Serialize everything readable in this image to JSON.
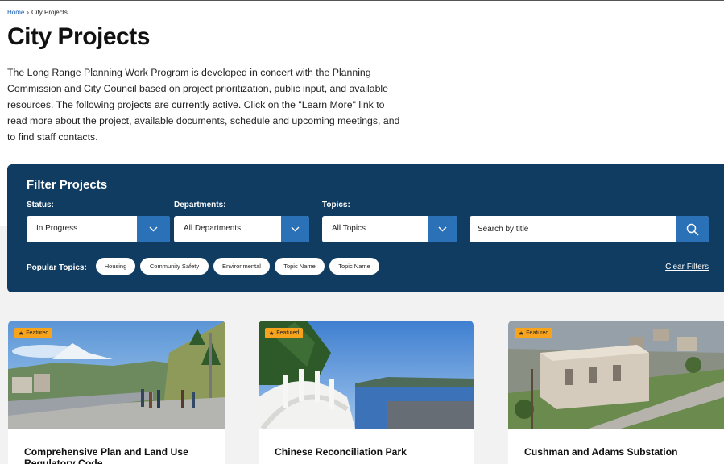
{
  "breadcrumb": {
    "home": "Home",
    "separator": "›",
    "current": "City Projects"
  },
  "page_title": "City Projects",
  "intro": "The Long Range Planning Work Program is developed in concert with the Planning Commission and City Council based on project prioritization, public input, and available resources. The following projects are currently active. Click on the \"Learn More\" link to read more about the project, available documents, schedule and upcoming meetings, and to find staff contacts.",
  "filter": {
    "title": "Filter Projects",
    "status": {
      "label": "Status:",
      "value": "In Progress"
    },
    "departments": {
      "label": "Departments:",
      "value": "All Departments"
    },
    "topics": {
      "label": "Topics:",
      "value": "All Topics"
    },
    "search": {
      "placeholder": "Search by title"
    },
    "popular_label": "Popular Topics:",
    "popular_topics": [
      "Housing",
      "Community Safety",
      "Environmental",
      "Topic Name",
      "Topic Name"
    ],
    "clear_label": "Clear Filters"
  },
  "cards": [
    {
      "badge": "Featured",
      "title": "Comprehensive Plan and Land Use Regulatory Code"
    },
    {
      "badge": "Featured",
      "title": "Chinese Reconciliation Park"
    },
    {
      "badge": "Featured",
      "title": "Cushman and Adams Substation"
    }
  ],
  "icons": {
    "chevron": "chevron-down-icon",
    "search": "search-icon",
    "star": "star-icon"
  },
  "colors": {
    "filter_bg": "#0f3c60",
    "button_blue": "#2b71b7",
    "badge": "#f7a31c",
    "link": "#1a5fb4"
  }
}
